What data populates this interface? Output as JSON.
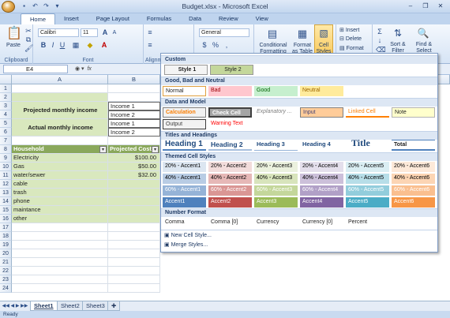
{
  "window": {
    "title": "Budget.xlsx - Microsoft Excel",
    "controls": [
      "–",
      "❐",
      "✕"
    ]
  },
  "ribbon_tabs": [
    "Home",
    "Insert",
    "Page Layout",
    "Formulas",
    "Data",
    "Review",
    "View"
  ],
  "ribbon": {
    "paste": "Paste",
    "clipboard": "Clipboard",
    "font": "Font",
    "alignment": "Alignm",
    "font_name": "Calibri",
    "font_size": "11",
    "number_format": "General",
    "conditional_formatting": "Conditional Formatting",
    "format_as_table": "Format as Table",
    "cell_styles": "Cell Styles",
    "insert": "Insert",
    "delete": "Delete",
    "format": "Format",
    "sort_filter": "Sort & Filter",
    "find_select": "Find & Select"
  },
  "formula_bar": {
    "name_box": "E4",
    "fx": "fx",
    "value": ""
  },
  "columns": [
    "A",
    "B"
  ],
  "rows": [
    {
      "n": "1",
      "a": "",
      "b": ""
    },
    {
      "n": "2",
      "a": "",
      "b": ""
    },
    {
      "n": "3",
      "a": "Projected monthly income",
      "b": "Income 1"
    },
    {
      "n": "4",
      "a": "",
      "b": "Income 2"
    },
    {
      "n": "5",
      "a": "Actual monthly income",
      "b": "Income 1"
    },
    {
      "n": "6",
      "a": "",
      "b": "Income 2"
    },
    {
      "n": "7",
      "a": "",
      "b": ""
    },
    {
      "n": "8",
      "a": "Household",
      "b": "Projected Cost"
    },
    {
      "n": "9",
      "a": "Electricity",
      "b": "$100.00"
    },
    {
      "n": "10",
      "a": "Gas",
      "b": "$50.00"
    },
    {
      "n": "11",
      "a": "water/sewer",
      "b": "$32.00"
    },
    {
      "n": "12",
      "a": "cable",
      "b": ""
    },
    {
      "n": "13",
      "a": "trash",
      "b": ""
    },
    {
      "n": "14",
      "a": "phone",
      "b": ""
    },
    {
      "n": "15",
      "a": "maintance",
      "b": ""
    },
    {
      "n": "16",
      "a": "other",
      "b": ""
    },
    {
      "n": "17",
      "a": "",
      "b": ""
    },
    {
      "n": "18",
      "a": "",
      "b": ""
    },
    {
      "n": "19",
      "a": "",
      "b": ""
    },
    {
      "n": "20",
      "a": "",
      "b": ""
    },
    {
      "n": "21",
      "a": "",
      "b": ""
    },
    {
      "n": "22",
      "a": "",
      "b": ""
    },
    {
      "n": "23",
      "a": "",
      "b": ""
    },
    {
      "n": "24",
      "a": "",
      "b": ""
    }
  ],
  "sheets": [
    "Sheet1",
    "Sheet2",
    "Sheet3"
  ],
  "status": "Ready",
  "gallery": {
    "custom": "Custom",
    "style1": "Style 1",
    "style2": "Style 2",
    "good_bad": "Good, Bad and Neutral",
    "normal": "Normal",
    "bad": "Bad",
    "good": "Good",
    "neutral": "Neutral",
    "data_model": "Data and Model",
    "calculation": "Calculation",
    "check_cell": "Check Cell",
    "explanatory": "Explanatory ...",
    "input": "Input",
    "linked_cell": "Linked Cell",
    "note": "Note",
    "output": "Output",
    "warning": "Warning Text",
    "titles": "Titles and Headings",
    "h1": "Heading 1",
    "h2": "Heading 2",
    "h3": "Heading 3",
    "h4": "Heading 4",
    "title": "Title",
    "total": "Total",
    "themed": "Themed Cell Styles",
    "themed_rows": [
      [
        "20% - Accent1",
        "20% - Accent2",
        "20% - Accent3",
        "20% - Accent4",
        "20% - Accent5",
        "20% - Accent6"
      ],
      [
        "40% - Accent1",
        "40% - Accent2",
        "40% - Accent3",
        "40% - Accent4",
        "40% - Accent5",
        "40% - Accent6"
      ],
      [
        "60% - Accent1",
        "60% - Accent2",
        "60% - Accent3",
        "60% - Accent4",
        "60% - Accent5",
        "60% - Accent6"
      ],
      [
        "Accent1",
        "Accent2",
        "Accent3",
        "Accent4",
        "Accent5",
        "Accent6"
      ]
    ],
    "number_format": "Number Format",
    "comma": "Comma",
    "comma0": "Comma [0]",
    "currency": "Currency",
    "currency0": "Currency [0]",
    "percent": "Percent",
    "new_style": "New Cell Style...",
    "merge_styles": "Merge Styles..."
  }
}
